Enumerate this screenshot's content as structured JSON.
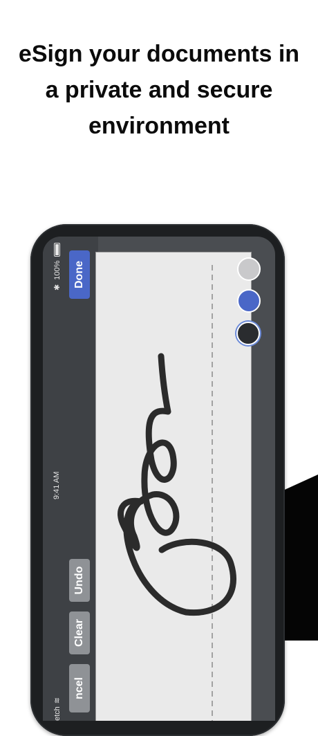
{
  "headline": {
    "line1": "eSign your documents in",
    "line2": "a private and secure",
    "line3": "environment"
  },
  "status_bar": {
    "battery": "100%",
    "bluetooth_icon": "bluetooth-icon",
    "battery_icon": "battery-icon",
    "time": "9:41 AM",
    "app_partial": "etch",
    "wifi_icon": "wifi-icon"
  },
  "toolbar": {
    "done_label": "Done",
    "undo_label": "Undo",
    "clear_label": "Clear",
    "cancel_label": "ncel"
  },
  "colors": {
    "accent_blue": "#4a67c7",
    "swatch_gray": "#c9c9cb",
    "swatch_blue": "#4a67c7",
    "swatch_black": "#2a2c2f",
    "selected_swatch": "black"
  }
}
